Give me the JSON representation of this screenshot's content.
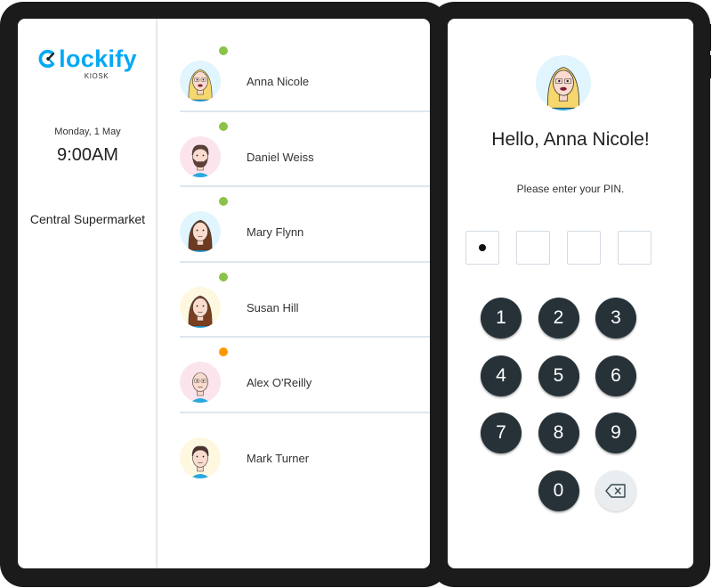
{
  "app": {
    "logo_text": "lockify",
    "logo_subtitle": "KIOSK",
    "brand_color": "#03a9f4"
  },
  "sidebar": {
    "date": "Monday, 1 May",
    "time": "9:00AM",
    "location": "Central Supermarket"
  },
  "employees": [
    {
      "name": "Anna Nicole",
      "status": "active",
      "status_color": "#8bc34a",
      "avatar_bg": "#e1f5fe"
    },
    {
      "name": "Daniel Weiss",
      "status": "active",
      "status_color": "#8bc34a",
      "avatar_bg": "#fce4ec"
    },
    {
      "name": "Mary Flynn",
      "status": "active",
      "status_color": "#8bc34a",
      "avatar_bg": "#e1f5fe"
    },
    {
      "name": "Susan Hill",
      "status": "active",
      "status_color": "#8bc34a",
      "avatar_bg": "#fff8e1"
    },
    {
      "name": "Alex O'Reilly",
      "status": "on-break",
      "status_color": "#ff9800",
      "avatar_bg": "#fce4ec"
    },
    {
      "name": "Mark Turner",
      "status": "none",
      "status_color": "",
      "avatar_bg": "#fff8e1"
    }
  ],
  "pin_panel": {
    "greeting": "Hello, Anna Nicole!",
    "prompt": "Please enter your PIN.",
    "digits_entered": 1,
    "pin_length": 4,
    "keys": [
      "1",
      "2",
      "3",
      "4",
      "5",
      "6",
      "7",
      "8",
      "9",
      "0"
    ],
    "backspace_icon": "backspace-icon",
    "key_color": "#263238"
  }
}
